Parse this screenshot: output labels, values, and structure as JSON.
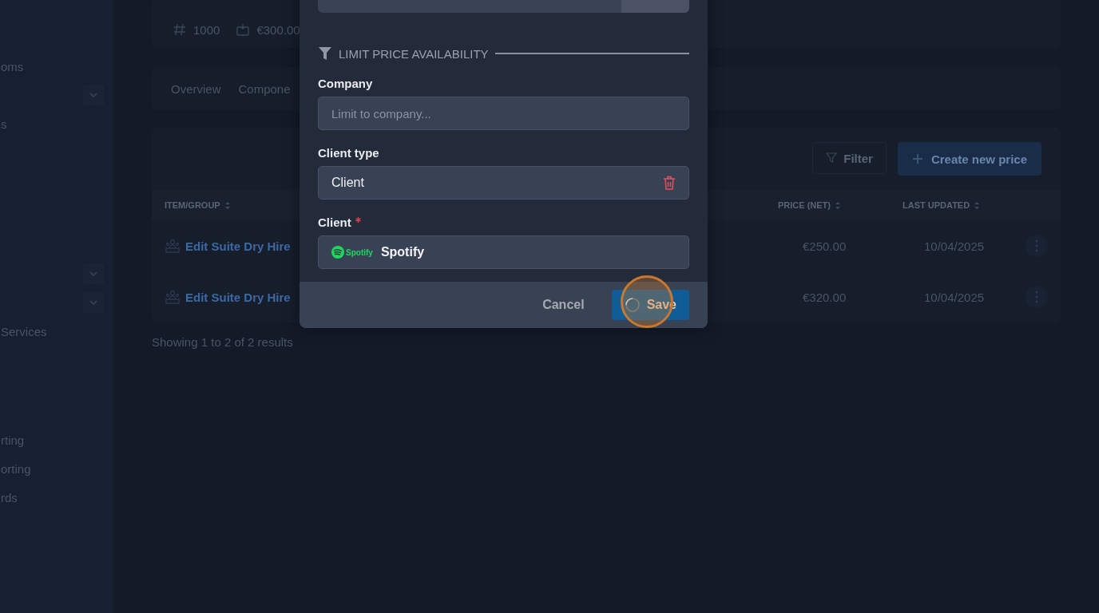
{
  "sidebar": {
    "groups": [
      {
        "items": [
          {
            "kind": "label",
            "text": "oms"
          },
          {
            "kind": "toggle",
            "expanded": false
          },
          {
            "kind": "label",
            "text": "s"
          }
        ]
      },
      {
        "items": [
          {
            "kind": "toggle",
            "expanded": false
          },
          {
            "kind": "toggle",
            "expanded": false
          },
          {
            "kind": "label",
            "text": "Services"
          }
        ]
      },
      {
        "items": [
          {
            "kind": "label",
            "text": "rting"
          },
          {
            "kind": "label",
            "text": "orting"
          },
          {
            "kind": "label",
            "text": "rds"
          }
        ]
      }
    ]
  },
  "summary": {
    "quantity": "1000",
    "price": "€300.00"
  },
  "tabs": [
    {
      "label": "Overview",
      "selected": false
    },
    {
      "label": "Compone",
      "selected": false
    }
  ],
  "toolbar": {
    "filter": "Filter",
    "create": "Create new price"
  },
  "table": {
    "columns": [
      {
        "label": "ITEM/GROUP"
      },
      {
        "label": "PRICE (NET)"
      },
      {
        "label": "LAST UPDATED"
      }
    ],
    "rows": [
      {
        "item": "Edit Suite Dry Hire",
        "price": "€250.00",
        "updated": "10/04/2025"
      },
      {
        "item": "Edit Suite Dry Hire",
        "price": "€320.00",
        "updated": "10/04/2025"
      }
    ]
  },
  "results": "Showing 1 to 2 of 2 results",
  "modal": {
    "section": "LIMIT PRICE AVAILABILITY",
    "fields": [
      {
        "kind": "input",
        "label": "Company",
        "required": false,
        "placeholder": "Limit to company..."
      },
      {
        "kind": "select",
        "label": "Client type",
        "required": false,
        "value": "Client",
        "removable": true
      },
      {
        "kind": "logo-select",
        "label": "Client",
        "required": true,
        "logo_text": "Spotify",
        "value": "Spotify"
      }
    ],
    "cancel": "Cancel",
    "save": "Save",
    "saving": true
  }
}
